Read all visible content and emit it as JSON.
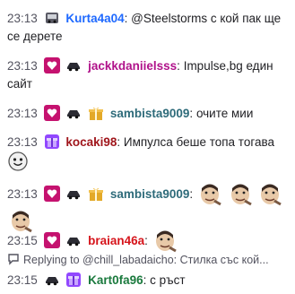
{
  "messages": [
    {
      "time": "23:13",
      "user": "Kurta4a04",
      "user_color": "#1e69ff",
      "text": "@Steelstorms с кой пак ще се дерете"
    },
    {
      "time": "23:13",
      "user": "jackkdaniielsss",
      "user_color": "#b0128a",
      "text": "Impulse,bg един сайт"
    },
    {
      "time": "23:13",
      "user": "sambista9009",
      "user_color": "#2e6b7a",
      "text": "очите мии"
    },
    {
      "time": "23:13",
      "user": "kocaki98",
      "user_color": "#a0161c",
      "text": "Импулса беше топа тогава"
    },
    {
      "time": "23:13",
      "user": "sambista9009",
      "user_color": "#2e6b7a",
      "text": ""
    },
    {
      "time": "23:15",
      "user": "braian46a",
      "user_color": "#d6141b",
      "text": ""
    },
    {
      "time": "23:15",
      "user": "Kart0fa96",
      "user_color": "#1b7a3e",
      "text": "с ръст"
    }
  ],
  "reply": {
    "text": "Replying to @chill_labadaicho: Стилка със кой..."
  },
  "icons": {
    "badge_sub": "heart-sub-badge-icon",
    "badge_car": "car-badge-icon",
    "badge_gift": "gift-badge-icon",
    "emote_face": "pepe-face-emote-icon",
    "emote_smile": "smile-emote-icon"
  }
}
